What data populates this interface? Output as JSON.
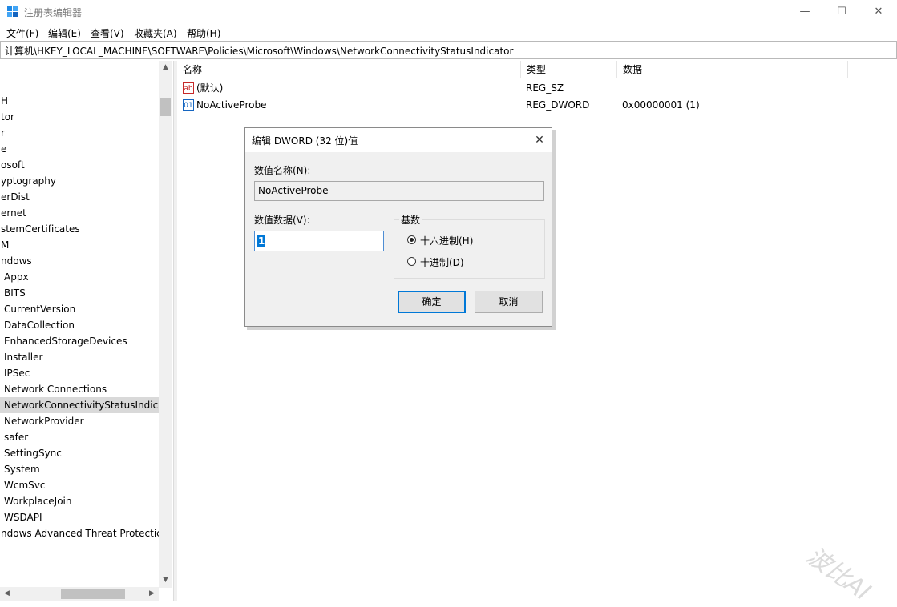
{
  "window": {
    "title": "注册表编辑器",
    "minimize": "—",
    "maximize": "☐",
    "close": "✕"
  },
  "menu": [
    "文件(F)",
    "编辑(E)",
    "查看(V)",
    "收藏夹(A)",
    "帮助(H)"
  ],
  "address": "计算机\\HKEY_LOCAL_MACHINE\\SOFTWARE\\Policies\\Microsoft\\Windows\\NetworkConnectivityStatusIndicator",
  "tree": {
    "items": [
      {
        "label": "H",
        "indent": 0
      },
      {
        "label": "tor",
        "indent": 0
      },
      {
        "label": "r",
        "indent": 0
      },
      {
        "label": "e",
        "indent": 0
      },
      {
        "label": "osoft",
        "indent": 0
      },
      {
        "label": "yptography",
        "indent": 0
      },
      {
        "label": "erDist",
        "indent": 0
      },
      {
        "label": "ernet",
        "indent": 0
      },
      {
        "label": "stemCertificates",
        "indent": 0
      },
      {
        "label": "M",
        "indent": 0
      },
      {
        "label": "ndows",
        "indent": 0
      },
      {
        "label": "Appx",
        "indent": 1
      },
      {
        "label": "BITS",
        "indent": 1
      },
      {
        "label": "CurrentVersion",
        "indent": 1
      },
      {
        "label": "DataCollection",
        "indent": 1
      },
      {
        "label": "EnhancedStorageDevices",
        "indent": 1
      },
      {
        "label": "Installer",
        "indent": 1
      },
      {
        "label": "IPSec",
        "indent": 1
      },
      {
        "label": "Network Connections",
        "indent": 1
      },
      {
        "label": "NetworkConnectivityStatusIndicat",
        "indent": 1,
        "selected": true
      },
      {
        "label": "NetworkProvider",
        "indent": 1
      },
      {
        "label": "safer",
        "indent": 1
      },
      {
        "label": "SettingSync",
        "indent": 1
      },
      {
        "label": "System",
        "indent": 1
      },
      {
        "label": "WcmSvc",
        "indent": 1
      },
      {
        "label": "WorkplaceJoin",
        "indent": 1
      },
      {
        "label": "WSDAPI",
        "indent": 1
      },
      {
        "label": "ndows Advanced Threat Protectic",
        "indent": 0
      }
    ],
    "scroll_up": "▲",
    "scroll_down": "▼",
    "scroll_left": "◀",
    "scroll_right": "▶"
  },
  "list": {
    "headers": [
      "名称",
      "类型",
      "数据"
    ],
    "rows": [
      {
        "icon": "string-value-icon",
        "icon_glyph": "ab",
        "name": "(默认)",
        "type": "REG_SZ",
        "data": ""
      },
      {
        "icon": "binary-value-icon",
        "icon_glyph": "01",
        "name": "NoActiveProbe",
        "type": "REG_DWORD",
        "data": "0x00000001 (1)"
      }
    ]
  },
  "dialog": {
    "title": "编辑 DWORD (32 位)值",
    "close": "✕",
    "name_label": "数值名称(N):",
    "name_value": "NoActiveProbe",
    "data_label": "数值数据(V):",
    "data_value": "1",
    "base_label": "基数",
    "radio_hex": "十六进制(H)",
    "radio_dec": "十进制(D)",
    "selected_base": "hex",
    "ok": "确定",
    "cancel": "取消"
  },
  "watermark": "波比AI",
  "colors": {
    "accent": "#0078d7",
    "selected_tree": "#d9d9d9",
    "dialog_bg": "#f0f0f0"
  }
}
